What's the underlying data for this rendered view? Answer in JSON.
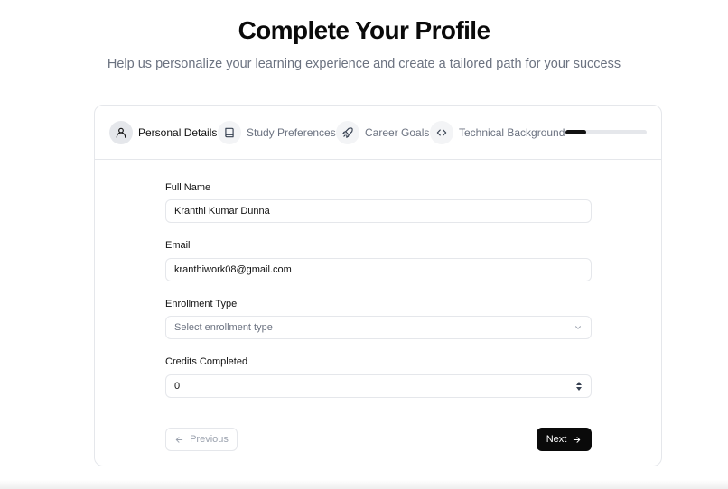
{
  "header": {
    "title": "Complete Your Profile",
    "subtitle": "Help us personalize your learning experience and create a tailored path for your success"
  },
  "stepper": {
    "steps": [
      {
        "label": "Personal Details",
        "icon": "user-icon",
        "active": true
      },
      {
        "label": "Study Preferences",
        "icon": "book-icon",
        "active": false
      },
      {
        "label": "Career Goals",
        "icon": "rocket-icon",
        "active": false
      },
      {
        "label": "Technical Background",
        "icon": "code-icon",
        "active": false
      }
    ],
    "progress_fraction": 0.25
  },
  "form": {
    "full_name": {
      "label": "Full Name",
      "value": "Kranthi Kumar Dunna"
    },
    "email": {
      "label": "Email",
      "value": "kranthiwork08@gmail.com"
    },
    "enrollment_type": {
      "label": "Enrollment Type",
      "placeholder": "Select enrollment type"
    },
    "credits_completed": {
      "label": "Credits Completed",
      "value": "0"
    }
  },
  "buttons": {
    "previous": "Previous",
    "next": "Next"
  },
  "colors": {
    "primary": "#0a0a0a",
    "muted_text": "#6b7280",
    "border": "#e5e7eb"
  }
}
